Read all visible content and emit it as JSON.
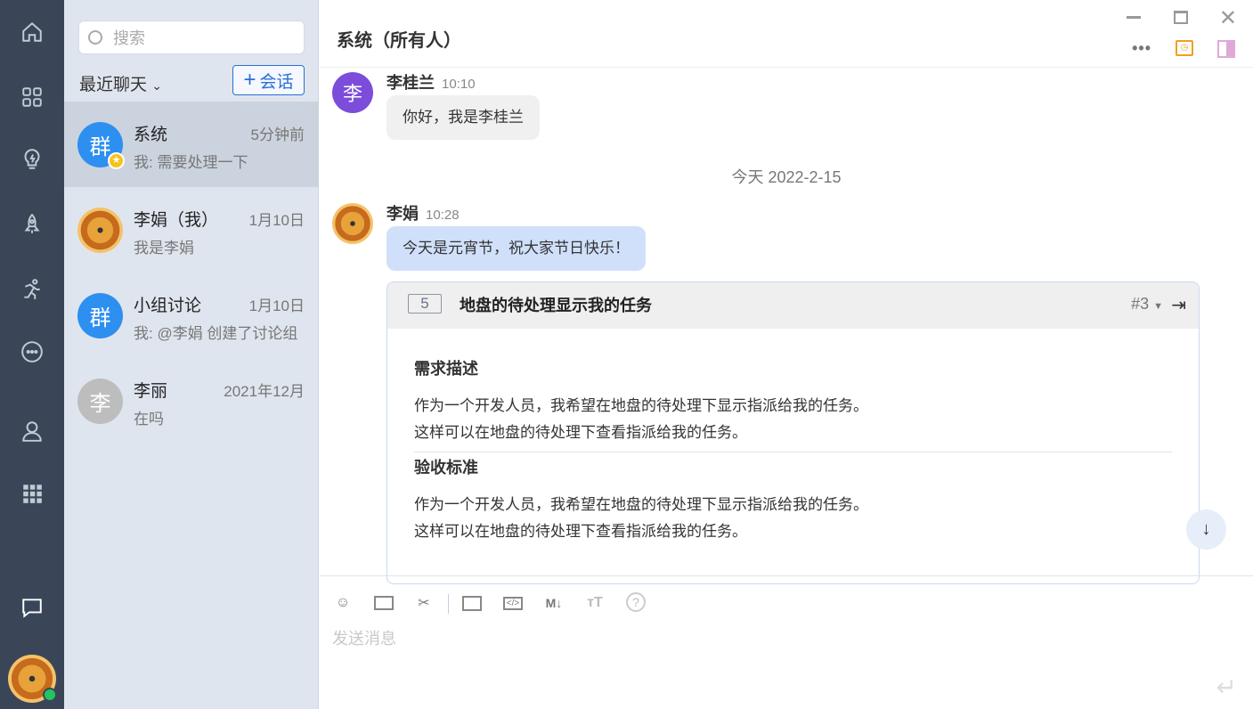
{
  "sidebar": {
    "icons": [
      "home-icon",
      "apps-icon",
      "idea-icon",
      "rocket-icon",
      "run-icon",
      "more-icon",
      "user-icon",
      "grid-icon",
      "chat-icon"
    ]
  },
  "list": {
    "search_placeholder": "搜索",
    "recent_label": "最近聊天",
    "new_label": "会话",
    "items": [
      {
        "avatar": "群",
        "name": "系统",
        "time": "5分钟前",
        "preview": "我: 需要处理一下",
        "color": "#2d8ff0"
      },
      {
        "avatar": "",
        "name": "李娟（我）",
        "time": "1月10日",
        "preview": "我是李娟",
        "color": ""
      },
      {
        "avatar": "群",
        "name": "小组讨论",
        "time": "1月10日",
        "preview": "我: @李娟 创建了讨论组",
        "color": "#2d8ff0"
      },
      {
        "avatar": "李",
        "name": "李丽",
        "time": "2021年12月",
        "preview": "在吗",
        "color": "#bdbdbd"
      }
    ]
  },
  "chat": {
    "title": "系统（所有人）",
    "messages": [
      {
        "avatar": "李",
        "sender": "李桂兰",
        "time": "10:10",
        "text": "你好，我是李桂兰"
      },
      {
        "sender": "李娟",
        "time": "10:28",
        "text": "今天是元宵节，祝大家节日快乐！"
      }
    ],
    "date_divider": "今天 2022-2-15",
    "card": {
      "number": "5",
      "title": "地盘的待处理显示我的任务",
      "ref": "#3",
      "sections": [
        {
          "heading": "需求描述",
          "lines": [
            "作为一个开发人员，我希望在地盘的待处理下显示指派给我的任务。",
            "这样可以在地盘的待处理下查看指派给我的任务。"
          ]
        },
        {
          "heading": "验收标准",
          "lines": [
            "作为一个开发人员，我希望在地盘的待处理下显示指派给我的任务。",
            "这样可以在地盘的待处理下查看指派给我的任务。"
          ]
        }
      ]
    },
    "composer_placeholder": "发送消息"
  }
}
